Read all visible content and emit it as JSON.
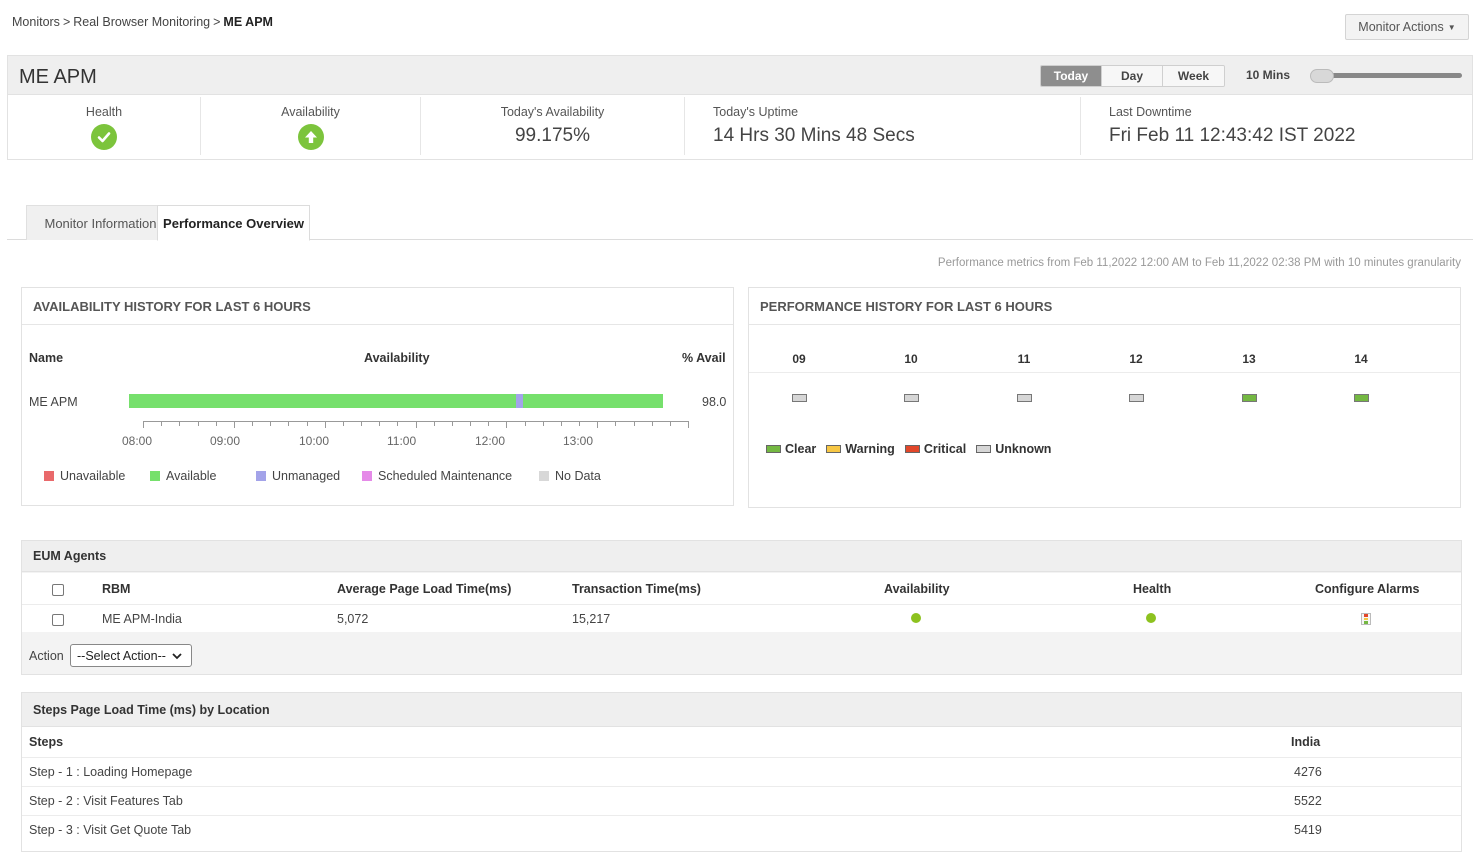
{
  "breadcrumb": {
    "item1": "Monitors",
    "sep": ">",
    "item2": "Real Browser Monitoring",
    "current": "ME APM"
  },
  "monitor_actions": {
    "label": "Monitor Actions"
  },
  "header": {
    "title": "ME APM",
    "range_buttons": [
      "Today",
      "Day",
      "Week"
    ],
    "active_range": "Today",
    "granularity": "10 Mins"
  },
  "stats": {
    "health_label": "Health",
    "availability_label": "Availability",
    "todays_availability_label": "Today's Availability",
    "todays_availability_value": "99.175%",
    "uptime_label": "Today's Uptime",
    "uptime_value": "14 Hrs 30 Mins 48 Secs",
    "downtime_label": "Last Downtime",
    "downtime_value": "Fri Feb 11 12:43:42 IST 2022"
  },
  "tabs": {
    "monitor_info": "Monitor Information",
    "performance_overview": "Performance Overview"
  },
  "metrics_note": "Performance metrics from Feb 11,2022 12:00 AM to Feb 11,2022 02:38 PM with 10 minutes granularity",
  "availability_history": {
    "title": "AVAILABILITY HISTORY FOR LAST 6 HOURS",
    "col_name": "Name",
    "col_availability": "Availability",
    "col_avail_pct": "% Avail",
    "row_name": "ME APM",
    "row_value": "98.0",
    "time_labels": [
      "08:00",
      "09:00",
      "10:00",
      "11:00",
      "12:00",
      "13:00"
    ],
    "unmanaged_fraction_start": 0.725,
    "unmanaged_fraction_end": 0.737,
    "legend": {
      "unavailable": "Unavailable",
      "available": "Available",
      "unmanaged": "Unmanaged",
      "scheduled": "Scheduled Maintenance",
      "nodata": "No Data"
    },
    "colors": {
      "available": "#76e06c",
      "unavailable": "#e9696b",
      "unmanaged": "#a3a3e9",
      "scheduled": "#e58ae8",
      "nodata": "#d8d8d8"
    }
  },
  "performance_history": {
    "title": "PERFORMANCE HISTORY FOR LAST 6 HOURS",
    "hours": [
      "09",
      "10",
      "11",
      "12",
      "13",
      "14"
    ],
    "states": [
      "Unknown",
      "Unknown",
      "Unknown",
      "Unknown",
      "Clear",
      "Clear"
    ],
    "legend": {
      "clear": "Clear",
      "warning": "Warning",
      "critical": "Critical",
      "unknown": "Unknown"
    },
    "colors": {
      "clear": "#74b842",
      "warning": "#f7c744",
      "critical": "#e2472a",
      "unknown": "#d6d6d6"
    }
  },
  "eum_agents": {
    "title": "EUM Agents",
    "headers": {
      "rbm": "RBM",
      "avg_page_load": "Average Page Load Time(ms)",
      "transaction": "Transaction Time(ms)",
      "availability": "Availability",
      "health": "Health",
      "configure": "Configure Alarms"
    },
    "row": {
      "name": "ME APM-India",
      "avg_page_load": "5,072",
      "transaction": "15,217"
    },
    "action_label": "Action",
    "action_select": "--Select Action--"
  },
  "steps": {
    "title": "Steps Page Load Time (ms) by Location",
    "col_steps": "Steps",
    "col_location": "India",
    "rows": [
      {
        "step": "Step - 1 : Loading Homepage",
        "value": "4276"
      },
      {
        "step": "Step - 2 : Visit Features Tab",
        "value": "5522"
      },
      {
        "step": "Step - 3 : Visit Get Quote Tab",
        "value": "5419"
      }
    ]
  }
}
